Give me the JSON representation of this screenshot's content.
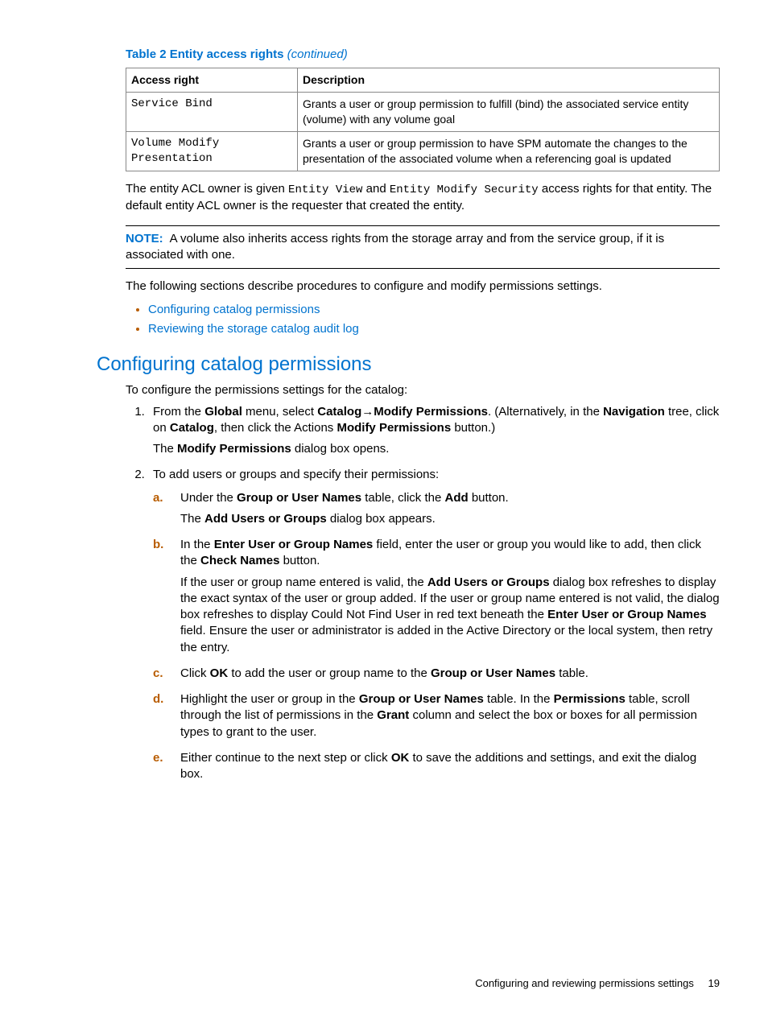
{
  "table_caption_prefix": "Table 2 Entity access rights ",
  "table_caption_suffix": "(continued)",
  "table": {
    "headers": [
      "Access right",
      "Description"
    ],
    "rows": [
      {
        "access": "Service Bind",
        "desc": "Grants a user or group permission to fulfill (bind) the associated service entity (volume) with any volume goal"
      },
      {
        "access": "Volume Modify Presentation",
        "desc": "Grants a user or group permission to have SPM automate the changes to the presentation of the associated volume when a referencing goal is updated"
      }
    ]
  },
  "para_owner_pre": "The entity ACL owner is given ",
  "para_owner_code1": "Entity View",
  "para_owner_mid": " and ",
  "para_owner_code2": "Entity Modify Security",
  "para_owner_post": " access rights for that entity. The default entity ACL owner is the requester that created the entity.",
  "note_label": "NOTE:",
  "note_text": "A volume also inherits access rights from the storage array and from the service group, if it is associated with one.",
  "para_following": "The following sections describe procedures to configure and modify permissions settings.",
  "links": [
    "Configuring catalog permissions",
    "Reviewing the storage catalog audit log"
  ],
  "section_heading": "Configuring catalog permissions",
  "intro_line": "To configure the permissions settings for the catalog:",
  "step1": {
    "t1": "From the ",
    "b1": "Global",
    "t2": " menu, select ",
    "b2": "Catalog",
    "arrow": "→",
    "b3": "Modify Permissions",
    "t3": ". (Alternatively, in the ",
    "b4": "Navigation",
    "t4": " tree, click on ",
    "b5": "Catalog",
    "t5": ", then click the Actions ",
    "b6": "Modify Permissions",
    "t6": " button.)",
    "result_pre": "The ",
    "result_b": "Modify Permissions",
    "result_post": " dialog box opens."
  },
  "step2_intro": "To add users or groups and specify their permissions:",
  "step2a": {
    "t1": "Under the ",
    "b1": "Group or User Names",
    "t2": " table, click the ",
    "b2": "Add",
    "t3": " button.",
    "result_pre": "The ",
    "result_b": "Add Users or Groups",
    "result_post": " dialog box appears."
  },
  "step2b": {
    "t1": "In the ",
    "b1": "Enter User or Group Names",
    "t2": " field, enter the user or group you would like to add, then click the ",
    "b2": "Check Names",
    "t3": " button.",
    "p2_t1": "If the user or group name entered is valid, the ",
    "p2_b1": "Add Users or Groups",
    "p2_t2": " dialog box refreshes to display the exact syntax of the user or group added. If the user or group name entered is not valid, the dialog box refreshes to display Could Not Find User in red text beneath the ",
    "p2_b2": "Enter User or Group Names",
    "p2_t3": " field. Ensure the user or administrator is added in the Active Directory or the local system, then retry the entry."
  },
  "step2c": {
    "t1": "Click ",
    "b1": "OK",
    "t2": " to add the user or group name to the ",
    "b2": "Group or User Names",
    "t3": " table."
  },
  "step2d": {
    "t1": "Highlight the user or group in the ",
    "b1": "Group or User Names",
    "t2": " table. In the ",
    "b2": "Permissions",
    "t3": " table, scroll through the list of permissions in the ",
    "b3": "Grant",
    "t4": " column and select the box or boxes for all permission types to grant to the user."
  },
  "step2e": {
    "t1": "Either continue to the next step or click ",
    "b1": "OK",
    "t2": " to save the additions and settings, and exit the dialog box."
  },
  "markers": {
    "a": "a.",
    "b": "b.",
    "c": "c.",
    "d": "d.",
    "e": "e."
  },
  "footer_text": "Configuring and reviewing permissions settings",
  "footer_page": "19"
}
